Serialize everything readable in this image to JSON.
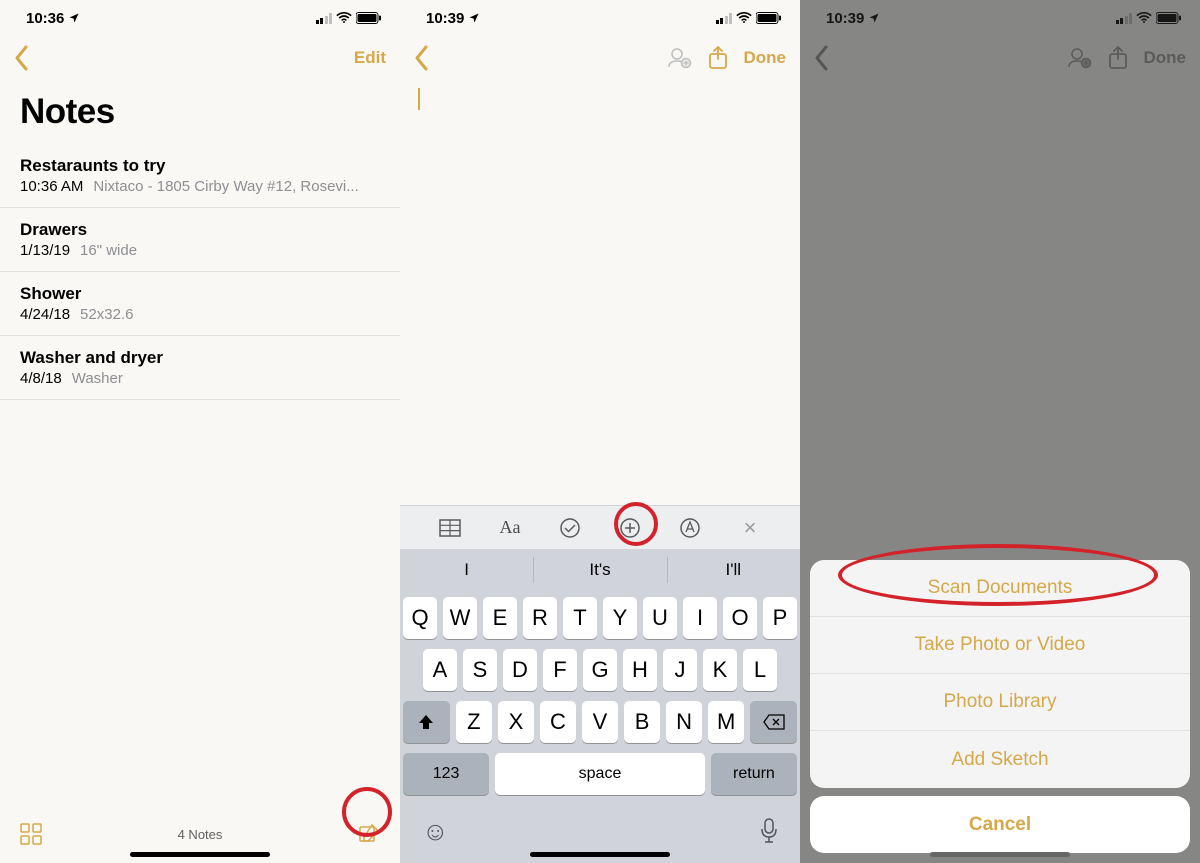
{
  "panel1": {
    "time": "10:36",
    "title": "Notes",
    "edit_label": "Edit",
    "notes": [
      {
        "title": "Restaraunts to try",
        "date": "10:36 AM",
        "preview": "Nixtaco - 1805 Cirby Way #12, Rosevi..."
      },
      {
        "title": "Drawers",
        "date": "1/13/19",
        "preview": "16\" wide"
      },
      {
        "title": "Shower",
        "date": "4/24/18",
        "preview": "52x32.6"
      },
      {
        "title": "Washer and dryer",
        "date": "4/8/18",
        "preview": "Washer"
      }
    ],
    "count_label": "4 Notes"
  },
  "panel2": {
    "time": "10:39",
    "done_label": "Done",
    "suggestions": [
      "I",
      "It's",
      "I'll"
    ],
    "kbd": {
      "row1": [
        "Q",
        "W",
        "E",
        "R",
        "T",
        "Y",
        "U",
        "I",
        "O",
        "P"
      ],
      "row2": [
        "A",
        "S",
        "D",
        "F",
        "G",
        "H",
        "J",
        "K",
        "L"
      ],
      "row3": [
        "Z",
        "X",
        "C",
        "V",
        "B",
        "N",
        "M"
      ],
      "num_label": "123",
      "space_label": "space",
      "return_label": "return"
    },
    "fmt_icons": [
      "table-icon",
      "text-style-icon",
      "checklist-icon",
      "add-attachment-icon",
      "markup-icon",
      "dismiss-icon"
    ]
  },
  "panel3": {
    "time": "10:39",
    "done_label": "Done",
    "sheet": {
      "items": [
        "Scan Documents",
        "Take Photo or Video",
        "Photo Library",
        "Add Sketch"
      ],
      "cancel": "Cancel"
    }
  }
}
